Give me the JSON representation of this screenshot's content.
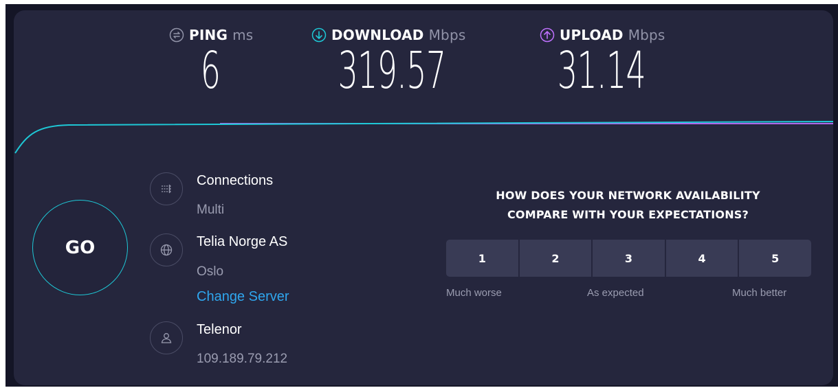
{
  "metrics": {
    "ping": {
      "label": "PING",
      "unit": "ms",
      "value": "6",
      "icon": "ping-icon",
      "color": "#9193a8"
    },
    "download": {
      "label": "DOWNLOAD",
      "unit": "Mbps",
      "value": "319.57",
      "icon": "download-arrow-icon",
      "color": "#1ec8d6"
    },
    "upload": {
      "label": "UPLOAD",
      "unit": "Mbps",
      "value": "31.14",
      "icon": "upload-arrow-icon",
      "color": "#bf71ff"
    }
  },
  "go_button": {
    "label": "GO"
  },
  "connections": {
    "title": "Connections",
    "value": "Multi",
    "icon": "connections-icon"
  },
  "server": {
    "name": "Telia Norge AS",
    "location": "Oslo",
    "change_label": "Change Server",
    "icon": "globe-icon"
  },
  "provider": {
    "name": "Telenor",
    "ip": "109.189.79.212",
    "icon": "user-icon"
  },
  "survey": {
    "question_line1": "HOW DOES YOUR NETWORK AVAILABILITY",
    "question_line2": "COMPARE WITH YOUR EXPECTATIONS?",
    "options": [
      "1",
      "2",
      "3",
      "4",
      "5"
    ],
    "label_low": "Much worse",
    "label_mid": "As expected",
    "label_high": "Much better"
  },
  "colors": {
    "background": "#25263d",
    "accent_cyan": "#1ec8d6",
    "accent_purple": "#bf71ff",
    "link": "#2fa6ee"
  }
}
